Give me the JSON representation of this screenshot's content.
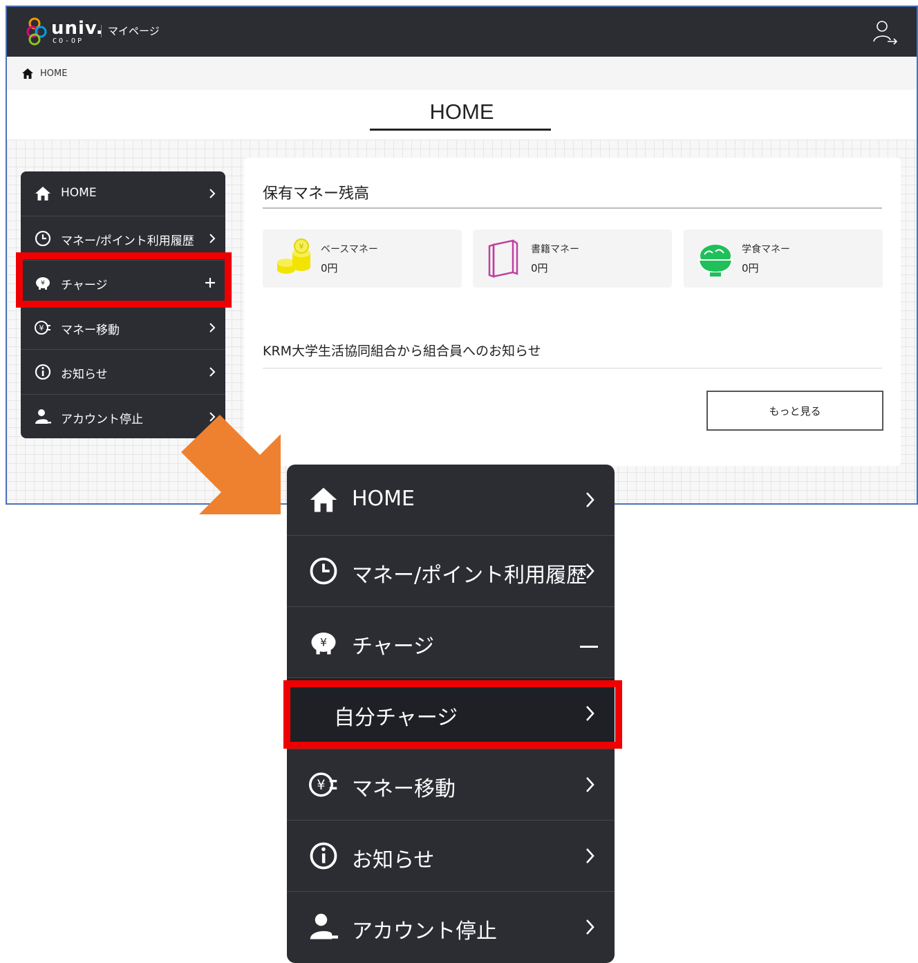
{
  "header": {
    "logo_word": "univ.",
    "logo_sub": "CO-OP",
    "section": "マイページ"
  },
  "breadcrumb": {
    "label": "HOME"
  },
  "page": {
    "title": "HOME"
  },
  "sidebar": {
    "items": [
      {
        "label": "HOME",
        "icon": "home-icon",
        "indicator": "chevron"
      },
      {
        "label": "マネー/ポイント利用履歴",
        "icon": "clock-icon",
        "indicator": "chevron"
      },
      {
        "label": "チャージ",
        "icon": "piggy-bank-icon",
        "indicator": "plus"
      },
      {
        "label": "マネー移動",
        "icon": "yen-transfer-icon",
        "indicator": "chevron"
      },
      {
        "label": "お知らせ",
        "icon": "info-icon",
        "indicator": "chevron"
      },
      {
        "label": "アカウント停止",
        "icon": "user-desk-icon",
        "indicator": "chevron"
      }
    ]
  },
  "balance": {
    "title": "保有マネー残高",
    "items": [
      {
        "name": "ベースマネー",
        "amount": "0円",
        "icon": "coins-icon",
        "color": "#f2e400"
      },
      {
        "name": "書籍マネー",
        "amount": "0円",
        "icon": "book-icon",
        "color": "#c03fa0"
      },
      {
        "name": "学食マネー",
        "amount": "0円",
        "icon": "rice-bowl-icon",
        "color": "#1fbf5a"
      }
    ]
  },
  "notices": {
    "title": "KRM大学生活協同組合から組合員へのお知らせ",
    "more_label": "もっと見る"
  },
  "expanded_menu": {
    "items": [
      {
        "label": "HOME",
        "icon": "home-icon",
        "indicator": "chevron"
      },
      {
        "label": "マネー/ポイント利用履歴",
        "icon": "clock-icon",
        "indicator": "chevron"
      },
      {
        "label": "チャージ",
        "icon": "piggy-bank-icon",
        "indicator": "minus"
      },
      {
        "label": "自分チャージ",
        "indicator": "chevron",
        "submenu": true
      },
      {
        "label": "マネー移動",
        "icon": "yen-transfer-icon",
        "indicator": "chevron"
      },
      {
        "label": "お知らせ",
        "icon": "info-icon",
        "indicator": "chevron"
      },
      {
        "label": "アカウント停止",
        "icon": "user-desk-icon",
        "indicator": "chevron"
      }
    ]
  },
  "colors": {
    "nav_bg": "#2c2d33",
    "highlight": "#ee0000",
    "arrow": "#ee8130",
    "frame": "#4a72b8"
  }
}
